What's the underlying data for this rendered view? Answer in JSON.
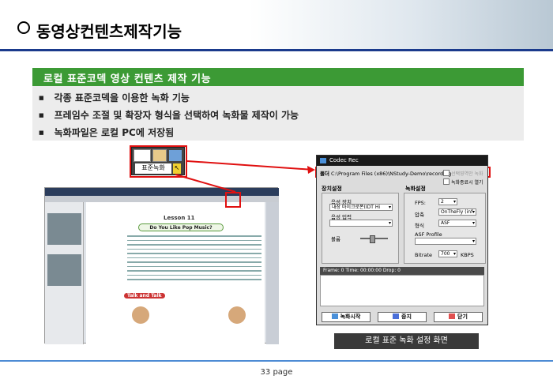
{
  "title": "동영상컨텐츠제작기능",
  "section": {
    "heading": "로컬 표준코덱 영상 컨텐츠 제작 기능",
    "bullets": [
      "각종 표준코덱을 이용한 녹화 기능",
      "프레임수 조절 및 확장자 형식을 선택하여 녹화물 제작이 가능",
      "녹화파일은 로컬 PC에 저장됨"
    ]
  },
  "popup": {
    "label": "표준녹화",
    "icons": [
      "home-icon",
      "record-icon"
    ]
  },
  "screenshot": {
    "lesson": "Lesson 11",
    "question": "Do You Like Pop Music?",
    "section2": "Talk and Talk"
  },
  "dialog": {
    "title": "Codec Rec",
    "folder_label": "폴더",
    "folder_path": "C:\\Program Files (x86)\\NStudy-Demo\\recording",
    "option_select_area": "선택영역만 녹화",
    "option_open_after": "녹화종료시 열기",
    "device_group": "장치설정",
    "record_group": "녹화설정",
    "audio_device_label": "음성 장치",
    "audio_device_value": "내장 마이크로폰(IDT Hi",
    "audio_input_label": "음성 입력",
    "volume_label": "볼륨",
    "fps_label": "FPS:",
    "fps_value": "2",
    "compression_label": "압축",
    "compression_value": "OnTheFly (inf",
    "format_label": "형식",
    "format_value": "ASF",
    "asf_profile_label": "ASF Profile",
    "bitrate_label": "Bitrate",
    "bitrate_value": "700",
    "bitrate_unit": "KBPS",
    "status": "Frame:  0     Time:  00:00:00     Drop:  0",
    "btn_start": "녹화시작",
    "btn_stop": "중지",
    "btn_close": "닫기"
  },
  "caption": "로컬 표준 녹화 설정 화면",
  "page": "33 page",
  "colors": {
    "section_green": "#3c9a35",
    "highlight_red": "#e01010",
    "header_blue": "#1a3a8c"
  }
}
